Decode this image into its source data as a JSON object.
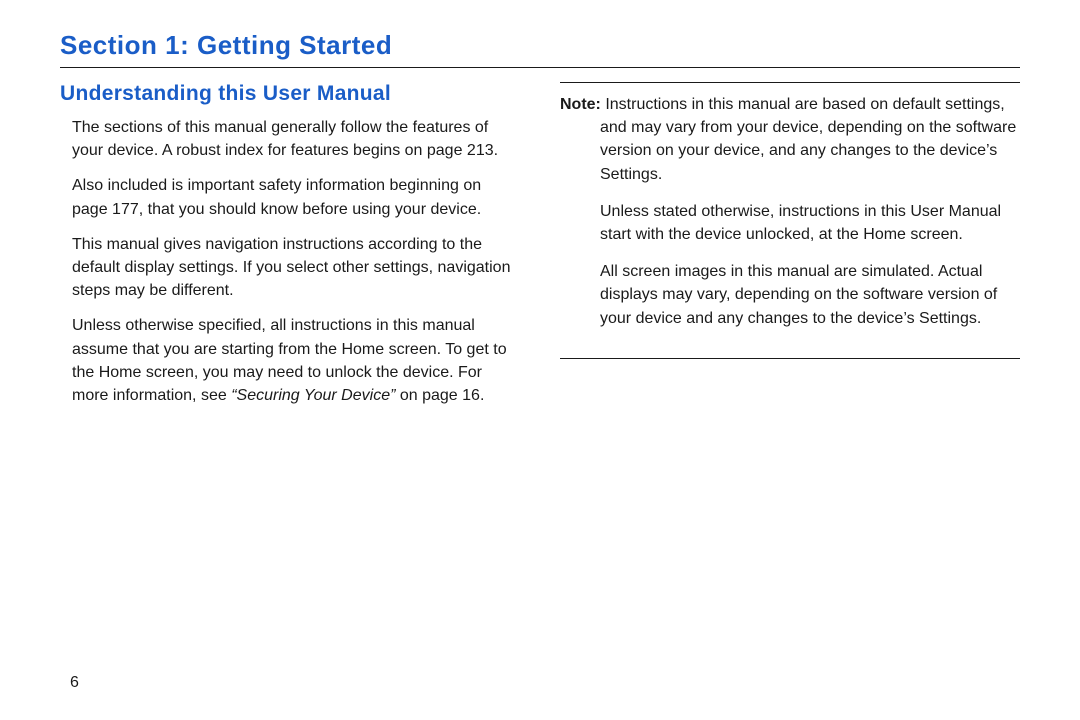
{
  "section_title": "Section 1: Getting Started",
  "subheading": "Understanding this User Manual",
  "left_paras": [
    "The sections of this manual generally follow the features of your device. A robust index for features begins on page 213.",
    "Also included is important safety information beginning on page 177, that you should know before using your device.",
    "This manual gives navigation instructions according to the default display settings. If you select other settings, navigation steps may be different."
  ],
  "left_para4_before": "Unless otherwise specified, all instructions in this manual assume that you are starting from the Home screen. To get to the Home screen, you may need to unlock the device. For more information, see ",
  "left_para4_italic": "“Securing Your Device”",
  "left_para4_after": " on page 16.",
  "note_label": "Note:",
  "note_para1": " Instructions in this manual are based on default settings, and may vary from your device, depending on the software version on your device, and any changes to the device’s Settings.",
  "note_para2": "Unless stated otherwise, instructions in this User Manual start with the device unlocked, at the Home screen.",
  "note_para3": "All screen images in this manual are simulated. Actual displays may vary, depending on the software version of your device and any changes to the device’s Settings.",
  "page_number": "6"
}
